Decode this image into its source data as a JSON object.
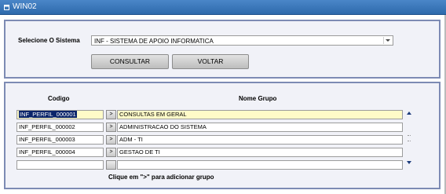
{
  "window": {
    "title": "WIN02"
  },
  "selection": {
    "label": "Selecione O Sistema",
    "system_value": "INF - SISTEMA DE APOIO INFORMATICA"
  },
  "buttons": {
    "consultar": "CONSULTAR",
    "voltar": "VOLTAR"
  },
  "grid": {
    "header_codigo": "Codigo",
    "header_nome": "Nome Grupo",
    "add_button_label": ">",
    "rows": [
      {
        "codigo": "INF_PERFIL_000001",
        "nome": "CONSULTAS EM GERAL"
      },
      {
        "codigo": "INF_PERFIL_000002",
        "nome": "ADMINISTRACAO DO SISTEMA"
      },
      {
        "codigo": "INF_PERFIL_000003",
        "nome": "ADM - TI"
      },
      {
        "codigo": "INF_PERFIL_000004",
        "nome": "GESTAO DE TI"
      },
      {
        "codigo": "",
        "nome": ""
      }
    ],
    "hint": "Clique em \">\" para adicionar grupo"
  },
  "colors": {
    "titlebar": "#3a78bd",
    "panel_border": "#7d8bb4",
    "panel_bg": "#f1f2f8",
    "current_row": "#fffbc8"
  },
  "icons": {
    "window": "window-icon",
    "scroll_up": "triangle-up-icon",
    "scroll_down": "triangle-down-icon"
  }
}
